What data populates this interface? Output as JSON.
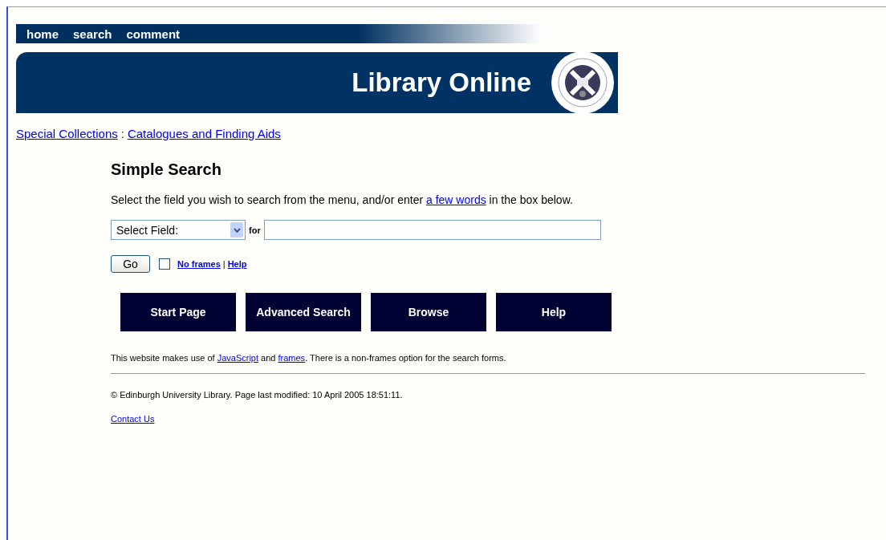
{
  "nav": [
    "home",
    "search",
    "comment"
  ],
  "banner": {
    "title": "Library Online"
  },
  "breadcrumb": [
    "Special Collections",
    "Catalogues and Finding Aids"
  ],
  "breadcrumb_separator": ":",
  "heading": "Simple Search",
  "intro": {
    "before": "Select the field you wish to search from the menu, and/or enter",
    "link": "a few words",
    "after": "in the box below."
  },
  "search": {
    "field_select": "Select Field:",
    "for_label": "for",
    "go": "Go",
    "no_frames": {
      "checked": false,
      "label": "No frames"
    },
    "separator": "|",
    "help": "Help"
  },
  "buttons": [
    "Start Page",
    "Advanced Search",
    "Browse",
    "Help"
  ],
  "notice": {
    "before": "This website makes use of",
    "link1": "JavaScript",
    "middle": "and",
    "link2": "frames",
    "after": ". There is a non-frames option for the search forms."
  },
  "copyright": "© Edinburgh University Library. Page last modified: 10 April 2005 18:51:11.",
  "contact": "Contact Us"
}
